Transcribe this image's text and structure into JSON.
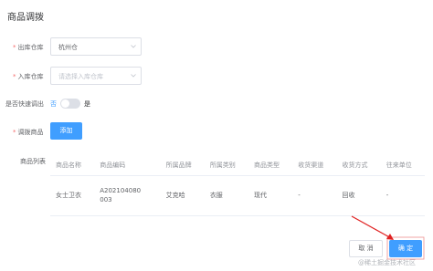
{
  "dialog": {
    "title": "商品调拨"
  },
  "form": {
    "out_warehouse": {
      "label": "出库仓库",
      "value": "杭州仓"
    },
    "in_warehouse": {
      "label": "入库仓库",
      "placeholder": "请选择入库仓库"
    },
    "fast_out": {
      "label": "是否快速调出",
      "off_text": "否",
      "on_text": "是"
    },
    "goods": {
      "label": "调拨商品",
      "add_label": "添加"
    }
  },
  "table": {
    "label": "商品列表",
    "columns": [
      "商品名称",
      "商品编码",
      "所属品牌",
      "所属类别",
      "商品类型",
      "收货渠道",
      "收货方式",
      "往来单位"
    ],
    "rows": [
      [
        "女士卫衣",
        "A202104080003",
        "艾克哈",
        "衣服",
        "现代",
        "-",
        "回收",
        "-"
      ]
    ]
  },
  "footer": {
    "cancel_label": "取 消",
    "ok_label": "确 定"
  },
  "watermark": "@稀土掘金技术社区",
  "colors": {
    "primary": "#409eff",
    "required": "#f56c6c"
  }
}
